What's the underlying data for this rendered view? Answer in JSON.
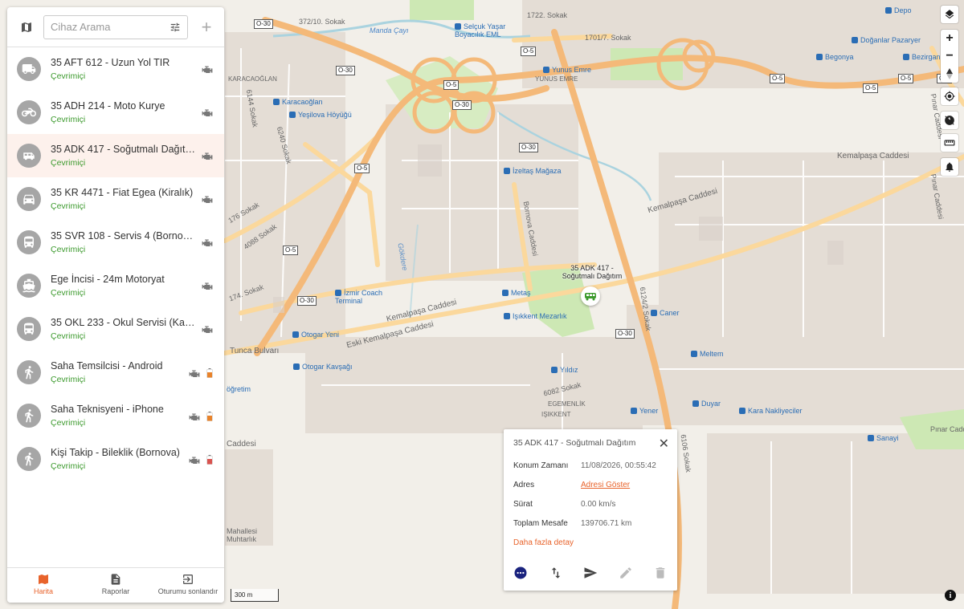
{
  "search": {
    "placeholder": "Cihaz Arama"
  },
  "devices": [
    {
      "name": "35 AFT 612 - Uzun Yol TIR",
      "status": "Çevrimiçi",
      "icon": "truck-icon"
    },
    {
      "name": "35 ADH 214 - Moto Kurye",
      "status": "Çevrimiçi",
      "icon": "motorcycle-icon"
    },
    {
      "name": "35 ADK 417 - Soğutmalı Dağıtım",
      "status": "Çevrimiçi",
      "icon": "van-icon"
    },
    {
      "name": "35 KR 4471 - Fiat Egea (Kiralık)",
      "status": "Çevrimiçi",
      "icon": "car-icon"
    },
    {
      "name": "35 SVR 108 - Servis 4 (Bornova-...",
      "status": "Çevrimiçi",
      "icon": "bus-icon"
    },
    {
      "name": "Ege İncisi - 24m Motoryat",
      "status": "Çevrimiçi",
      "icon": "boat-icon"
    },
    {
      "name": "35 OKL 233 - Okul Servisi (Karşıy...",
      "status": "Çevrimiçi",
      "icon": "bus-icon"
    },
    {
      "name": "Saha Temsilcisi - Android",
      "status": "Çevrimiçi",
      "icon": "person-icon",
      "battery": "#e8832b"
    },
    {
      "name": "Saha Teknisyeni - iPhone",
      "status": "Çevrimiçi",
      "icon": "person-icon",
      "battery": "#e8832b"
    },
    {
      "name": "Kişi Takip - Bileklik (Bornova)",
      "status": "Çevrimiçi",
      "icon": "person-icon",
      "battery": "#d9534f"
    }
  ],
  "nav": {
    "map": "Harita",
    "reports": "Raporlar",
    "logout": "Oturumu sonlandır"
  },
  "popup": {
    "title": "35 ADK 417 - Soğutmalı Dağıtım",
    "rows": [
      {
        "key": "Konum Zamanı",
        "value": "11/08/2026, 00:55:42"
      },
      {
        "key": "Adres",
        "value": "Adresi Göster"
      },
      {
        "key": "Sürat",
        "value": "0.00 km/s"
      },
      {
        "key": "Toplam Mesafe",
        "value": "139706.71 km"
      }
    ],
    "more": "Daha fazla detay"
  },
  "marker": {
    "label": "35 ADK 417 - Soğutmalı Dağıtım"
  },
  "scale": "300 m",
  "map_labels": {
    "kemalpasa1": "Kemalpaşa Caddesi",
    "kemalpasa2": "Kemalpaşa Caddesi",
    "kemalpasa3": "Eski Kemalpaşa Caddesi",
    "kemalpasa4": "Kemalpaşa Caddesi",
    "bornova": "Bornova Caddesi",
    "gokdere": "Gökdere",
    "karacaoglan": "Karacaoğlan",
    "karacaoglan_upper": "KARACAOĞLAN",
    "yesilova": "Yeşilova Höyüğü",
    "yunus": "Yunus Emre",
    "yunus_upper": "YUNUS EMRE",
    "izeltas": "İzeltaş Mağaza",
    "metas": "Metaş",
    "isikkent_mez": "Işıkkent Mezarlık",
    "izmir_coach": "İzmir Coach Terminal",
    "otogar_yeni": "Otogar Yeni",
    "otogar_kavsagi": "Otogar Kavşağı",
    "yildiz": "Yıldız",
    "egemenlik": "EGEMENLİK",
    "isikkent": "IŞIKKENT",
    "caner": "Caner",
    "meltem": "Meltem",
    "duyar": "Duyar",
    "yener": "Yener",
    "kara_nak": "Kara Nakliyeciler",
    "sanayi": "Sanayi",
    "depo": "Depo",
    "dogan": "Doğanlar Pazaryer",
    "begonya": "Begonya",
    "bezirgan": "Bezirgan",
    "selcuk": "Selçuk Yaşar Boyacılık EML",
    "manda": "Manda Çayı",
    "tunca": "Tunca Bulvarı",
    "sok6240": "6240 Sokak",
    "sok6144": "6144 Sokak",
    "sok4088": "4088 Sokak",
    "sok6082": "6082 Sokak",
    "sok6106": "6106 Sokak",
    "sok6124": "6124/2 Sokak",
    "sok1722": "1722. Sokak",
    "sok1701": "1701/7. Sokak",
    "sok372": "372/10. Sokak",
    "pinar1": "Pınar Caddesi",
    "pinar2": "Pınar Caddesi",
    "pinar3": "Pınar Caddesi",
    "mahallesi": "Mahallesi",
    "muhtarlik": "Muhtarlık",
    "ogretim": "öğretim",
    "caddesi_left": "Caddesi",
    "sok176": "176 Sokak",
    "sok174": "174. Sokak"
  },
  "shields": [
    "O-30",
    "O-30",
    "O-30",
    "O-30",
    "O-30",
    "O-30",
    "O-5",
    "O-5",
    "O-5",
    "O-5",
    "O-5",
    "O-5",
    "O-5",
    "O-5"
  ],
  "colors": {
    "accent": "#e8632b",
    "online": "#3c9a2d",
    "motorway": "#f4b979",
    "primary": "#fbd89c",
    "water": "#aad3df",
    "park": "#cde8b4"
  }
}
